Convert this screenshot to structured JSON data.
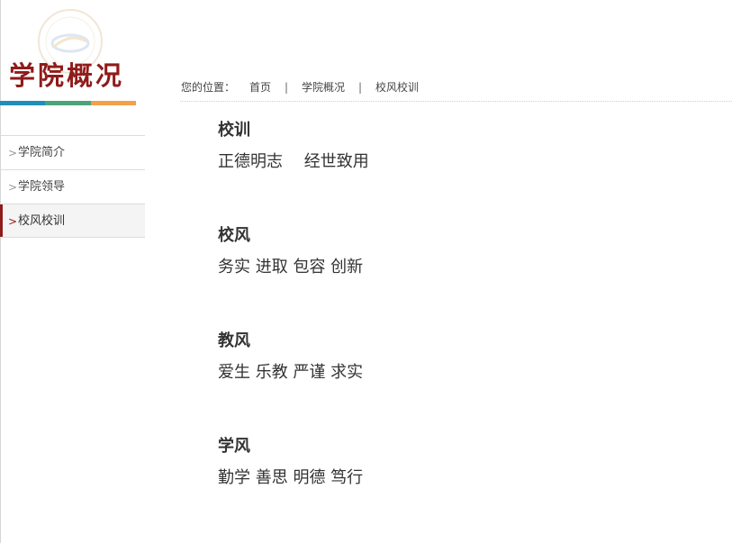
{
  "sidebar": {
    "title": "学院概况",
    "color_bar": [
      "#1f8fb8",
      "#4da47c",
      "#f0a14a"
    ],
    "items": [
      {
        "label": "学院简介",
        "active": false
      },
      {
        "label": "学院领导",
        "active": false
      },
      {
        "label": "校风校训",
        "active": true
      }
    ]
  },
  "breadcrumb": {
    "prefix": "您的位置：",
    "home": "首页",
    "separator": "|",
    "level1": "学院概况",
    "current": "校风校训"
  },
  "sections": [
    {
      "heading": "校训",
      "body": "正德明志　 经世致用"
    },
    {
      "heading": "校风",
      "body": "务实  进取  包容  创新"
    },
    {
      "heading": "教风",
      "body": "爱生  乐教  严谨  求实"
    },
    {
      "heading": "学风",
      "body": "勤学  善思  明德  笃行"
    }
  ],
  "colors": {
    "accent": "#8f1b1b"
  },
  "icons": [
    "logo-seal",
    "chevron-right-icon"
  ]
}
